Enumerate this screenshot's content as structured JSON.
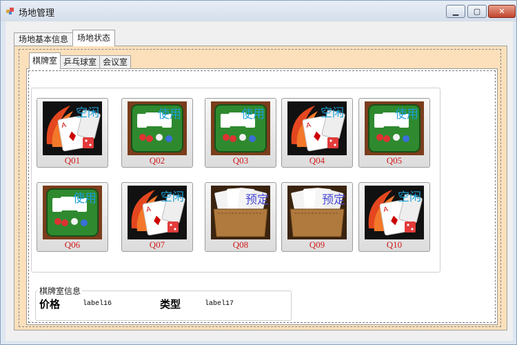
{
  "window": {
    "title": "场地管理",
    "min_symbol": "▁",
    "max_symbol": "▢",
    "close_symbol": "✕"
  },
  "tabs": [
    {
      "label": "场地基本信息",
      "active": false
    },
    {
      "label": "场地状态",
      "active": true
    }
  ],
  "room_tabs": [
    {
      "label": "棋牌室",
      "active": true
    },
    {
      "label": "乒乓球室",
      "active": false
    },
    {
      "label": "会议室",
      "active": false
    }
  ],
  "rooms": [
    {
      "id": "Q01",
      "status": "空闲",
      "style": "idle"
    },
    {
      "id": "Q02",
      "status": "使用",
      "style": "busy"
    },
    {
      "id": "Q03",
      "status": "使用",
      "style": "busy"
    },
    {
      "id": "Q04",
      "status": "空闲",
      "style": "idle"
    },
    {
      "id": "Q05",
      "status": "使用",
      "style": "busy"
    },
    {
      "id": "Q06",
      "status": "使用",
      "style": "busy"
    },
    {
      "id": "Q07",
      "status": "空闲",
      "style": "idle"
    },
    {
      "id": "Q08",
      "status": "预定",
      "style": "book"
    },
    {
      "id": "Q09",
      "status": "预定",
      "style": "book"
    },
    {
      "id": "Q10",
      "status": "空闲",
      "style": "idle"
    }
  ],
  "info": {
    "legend": "棋牌室信息",
    "price_label": "价格",
    "price_value": "label16",
    "type_label": "类型",
    "type_value": "label17"
  },
  "colors": {
    "idle_bg": "#111111",
    "busy_bg": "#2c7a2c",
    "book_bg": "#8a5a2b",
    "id_text": "#d11a1a"
  }
}
